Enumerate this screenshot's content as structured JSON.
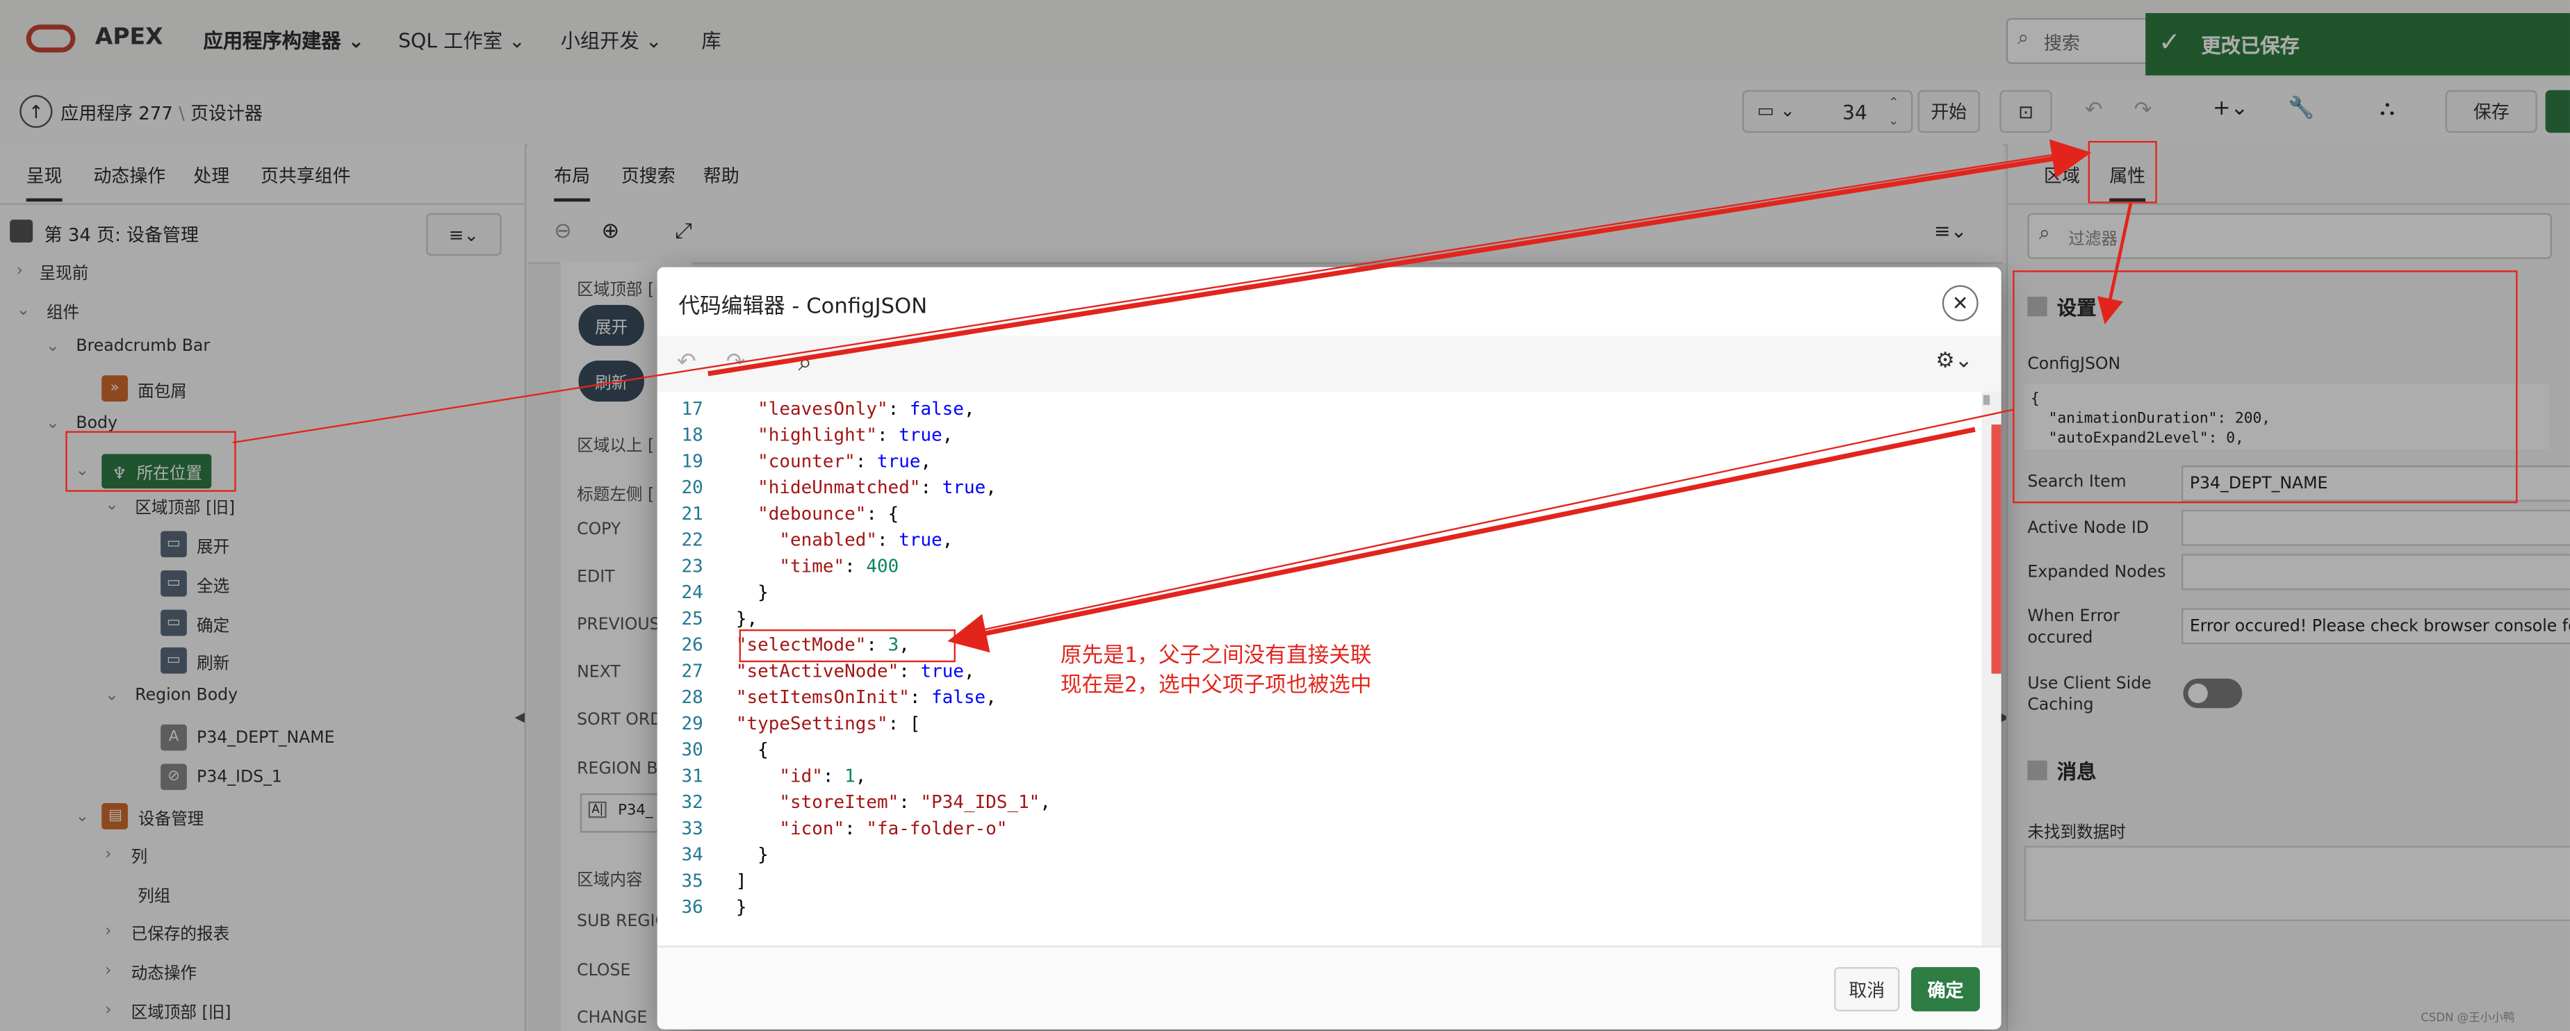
{
  "topbar": {
    "brand": "APEX",
    "nav": [
      "应用程序构建器",
      "SQL 工作室",
      "小组开发",
      "库"
    ],
    "search_placeholder": "搜索",
    "toast": "更改已保存"
  },
  "toolbar": {
    "breadcrumb_app": "应用程序 277",
    "breadcrumb_page": "页设计器",
    "page_number": "34",
    "go_label": "开始",
    "save_label": "保存"
  },
  "left": {
    "tabs": [
      "呈现",
      "动态操作",
      "处理",
      "页共享组件"
    ],
    "page_title": "第 34 页: 设备管理",
    "tree": [
      "呈现前",
      "组件",
      "Breadcrumb Bar",
      "面包屑",
      "Body",
      "所在位置",
      "区域顶部 [旧]",
      "展开",
      "全选",
      "确定",
      "刷新",
      "Region Body",
      "P34_DEPT_NAME",
      "P34_IDS_1",
      "设备管理",
      "列",
      "列组",
      "已保存的报表",
      "动态操作",
      "区域顶部 [旧]"
    ]
  },
  "middle": {
    "tabs": [
      "布局",
      "页搜索",
      "帮助"
    ],
    "labels": [
      "区域顶部 [",
      "展开",
      "刷新",
      "区域以上 [",
      "标题左侧 [",
      "COPY",
      "EDIT",
      "PREVIOUS",
      "NEXT",
      "SORT ORD",
      "REGION BO",
      "P34_",
      "区域内容",
      "SUB REGIC",
      "CLOSE",
      "CHANGE"
    ]
  },
  "right": {
    "tabs": [
      "区域",
      "属性"
    ],
    "filter_placeholder": "过滤器",
    "section_settings": "设置",
    "config_label": "ConfigJSON",
    "config_preview": [
      "{",
      "  \"animationDuration\": 200,",
      "  \"autoExpand2Level\": 0,"
    ],
    "search_item_label": "Search Item",
    "search_item_value": "P34_DEPT_NAME",
    "active_node_label": "Active Node ID",
    "expanded_nodes_label": "Expanded Nodes",
    "when_error_label": "When Error occured",
    "when_error_value": "Error occured! Please check browser console for more",
    "client_cache_label": "Use Client Side Caching",
    "section_messages": "消息",
    "no_data_label": "未找到数据时"
  },
  "dialog": {
    "title": "代码编辑器 - ConfigJSON",
    "cancel_label": "取消",
    "ok_label": "确定",
    "line_numbers": [
      "17",
      "18",
      "19",
      "20",
      "21",
      "22",
      "23",
      "24",
      "25",
      "26",
      "27",
      "28",
      "29",
      "30",
      "31",
      "32",
      "33",
      "34",
      "35",
      "36"
    ],
    "code_lines": [
      "  \"leavesOnly\": false,",
      "  \"highlight\": true,",
      "  \"counter\": true,",
      "  \"hideUnmatched\": true,",
      "  \"debounce\": {",
      "    \"enabled\": true,",
      "    \"time\": 400",
      "  }",
      "},",
      "\"selectMode\": 3,",
      "\"setActiveNode\": true,",
      "\"setItemsOnInit\": false,",
      "\"typeSettings\": [",
      "  {",
      "    \"id\": 1,",
      "    \"storeItem\": \"P34_IDS_1\",",
      "    \"icon\": \"fa-folder-o\"",
      "  }",
      "]",
      "}"
    ]
  },
  "annotation": {
    "line1": "原先是1，父子之间没有直接关联",
    "line2": "现在是2，选中父项子项也被选中"
  },
  "watermark": "CSDN @王小小鸭",
  "colors": {
    "apex_red": "#c74634",
    "toast_green": "#2f7d3f",
    "ok_green": "#2e7d44",
    "annotation_red": "#e3241c"
  }
}
